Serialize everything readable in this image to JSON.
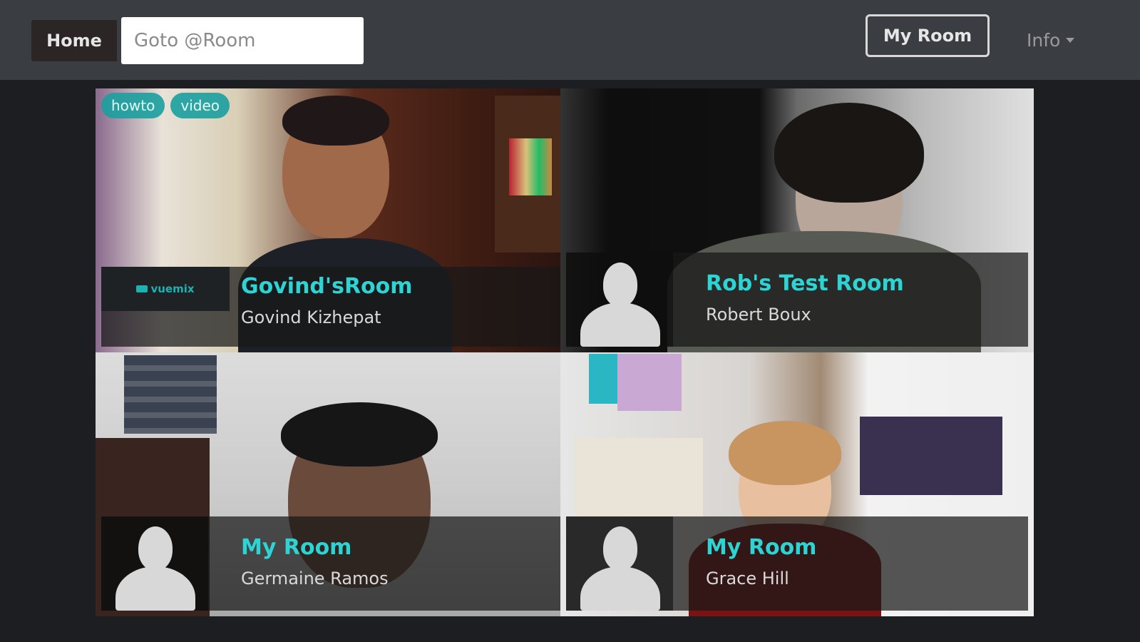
{
  "navbar": {
    "home_label": "Home",
    "goto_placeholder": "Goto @Room",
    "myroom_label": "My Room",
    "info_label": "Info"
  },
  "tiles": [
    {
      "room": "Govind'sRoom",
      "user": "Govind Kizhepat",
      "tags": [
        "howto",
        "video"
      ],
      "logo": "vuemix"
    },
    {
      "room": "Rob's Test Room",
      "user": "Robert Boux"
    },
    {
      "room": "My Room",
      "user": "Germaine Ramos"
    },
    {
      "room": "My Room",
      "user": "Grace Hill"
    }
  ],
  "colors": {
    "accent": "#2ed3d3",
    "navbar": "#3a3d42",
    "background": "#1c1e22"
  }
}
